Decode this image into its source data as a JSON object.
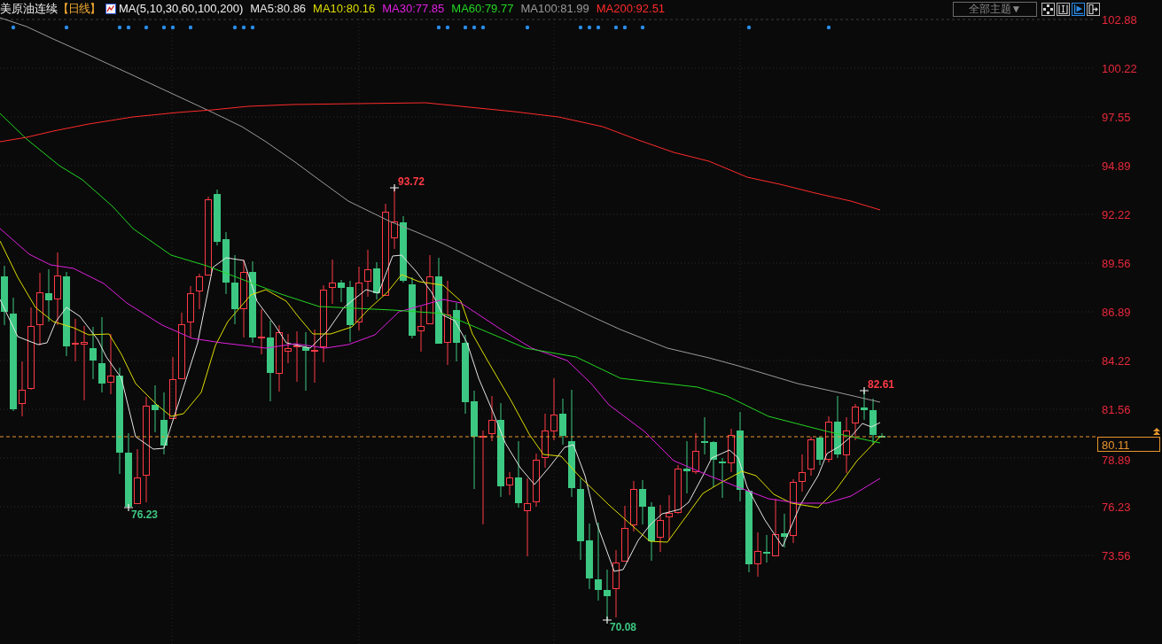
{
  "header": {
    "instrument": "美原油连续",
    "period": "【日线】",
    "indicator": "MA(5,10,30,60,100,200)",
    "ma_values": [
      {
        "text": "MA5:80.86",
        "color": "#e6e6e6"
      },
      {
        "text": "MA10:80.16",
        "color": "#dede00"
      },
      {
        "text": "MA30:77.85",
        "color": "#e020e0"
      },
      {
        "text": "MA60:79.77",
        "color": "#22d622"
      },
      {
        "text": "MA100:81.99",
        "color": "#9a9a9a"
      },
      {
        "text": "MA200:92.51",
        "color": "#ff2a2a"
      }
    ]
  },
  "toolbar": {
    "theme_menu": "全部主题▼",
    "view_buttons": [
      {
        "selected": false
      },
      {
        "selected": false
      },
      {
        "selected": true
      },
      {
        "selected": false
      }
    ]
  },
  "chart": {
    "annotations": [
      {
        "kind": "low",
        "text": "76.23"
      },
      {
        "kind": "high",
        "text": "93.72"
      },
      {
        "kind": "low",
        "text": "70.08"
      },
      {
        "kind": "high",
        "text": "82.61"
      }
    ]
  },
  "price_axis": {
    "ticks": [
      "102.88",
      "100.22",
      "97.55",
      "94.89",
      "92.22",
      "89.56",
      "86.89",
      "84.22",
      "81.56",
      "78.89",
      "76.23",
      "73.56"
    ],
    "last_price": "80.11"
  }
}
